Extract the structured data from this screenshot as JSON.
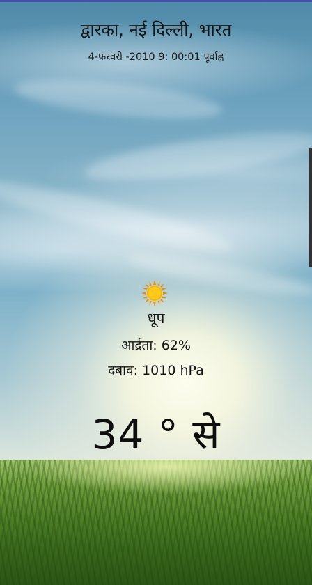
{
  "header": {
    "location": "द्वारका, नई दिल्ली, भारत",
    "datetime": "4-फरवरी -2010 9: 00:01 पूर्वाह्न"
  },
  "weather": {
    "icon": "sun-icon",
    "condition": "धूप",
    "humidity": "आर्द्रता: 62%",
    "pressure": "दबाव: 1010 hPa",
    "temperature": "34 ° से"
  },
  "colors": {
    "top_bar": "#4a4fb0",
    "sun_core": "#f5b800",
    "sun_rays": "#f08a00",
    "text": "#151515"
  }
}
